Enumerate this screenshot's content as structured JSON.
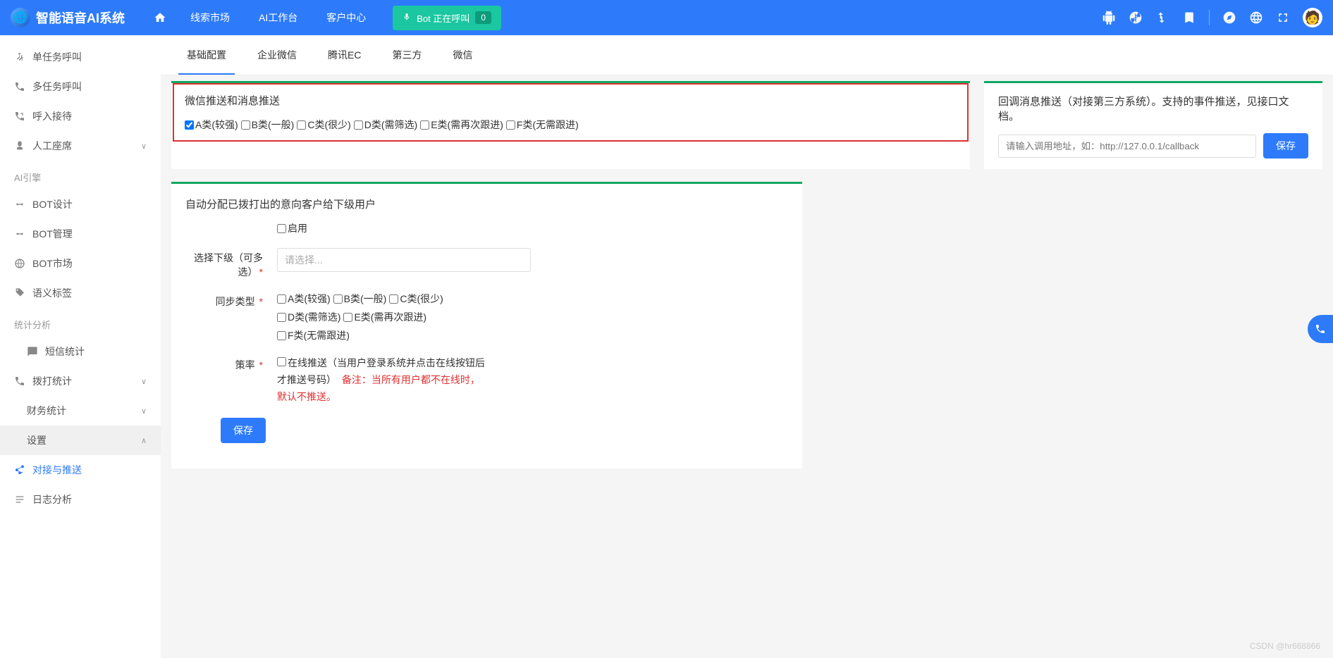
{
  "header": {
    "app_title": "智能语音AI系统",
    "nav": [
      "线索市场",
      "AI工作台",
      "客户中心"
    ],
    "bot_status_label": "Bot 正在呼叫",
    "bot_count": "0"
  },
  "sidebar": {
    "top_items": [
      {
        "icon": "call-split",
        "label": "单任务呼叫",
        "chev": false
      },
      {
        "icon": "phone",
        "label": "多任务呼叫",
        "chev": false
      },
      {
        "icon": "incoming",
        "label": "呼入接待",
        "chev": false
      },
      {
        "icon": "seat",
        "label": "人工座席",
        "chev": true
      }
    ],
    "group_ai": "AI引擎",
    "ai_items": [
      {
        "icon": "bot",
        "label": "BOT设计"
      },
      {
        "icon": "bot",
        "label": "BOT管理"
      },
      {
        "icon": "globe",
        "label": "BOT市场"
      },
      {
        "icon": "tag",
        "label": "语义标签"
      }
    ],
    "group_stat": "统计分析",
    "stat_items": [
      {
        "icon": "chat",
        "label": "短信统计",
        "chev": false
      },
      {
        "icon": "phone",
        "label": "拨打统计",
        "chev": true
      },
      {
        "icon": "",
        "label": "财务统计",
        "chev": true
      },
      {
        "icon": "",
        "label": "设置",
        "chev": true,
        "active_bg": true,
        "chev_up": true
      }
    ],
    "setting_sub": [
      {
        "icon": "share",
        "label": "对接与推送",
        "active": true
      },
      {
        "icon": "log",
        "label": "日志分析"
      }
    ]
  },
  "tabs": [
    "基础配置",
    "企业微信",
    "腾讯EC",
    "第三方",
    "微信"
  ],
  "active_tab": 0,
  "panel1": {
    "title": "微信推送和消息推送",
    "checks": [
      {
        "label": "A类(较强)",
        "checked": true
      },
      {
        "label": "B类(一般)",
        "checked": false
      },
      {
        "label": "C类(很少)",
        "checked": false
      },
      {
        "label": "D类(需筛选)",
        "checked": false
      },
      {
        "label": "E类(需再次跟进)",
        "checked": false
      },
      {
        "label": "F类(无需跟进)",
        "checked": false
      }
    ]
  },
  "panel_callback": {
    "title": "回调消息推送（对接第三方系统）。支持的事件推送，见接口文档。",
    "placeholder": "请输入调用地址，如：http://127.0.0.1/callback",
    "save_btn": "保存"
  },
  "panel2": {
    "title": "自动分配已拨打出的意向客户给下级用户",
    "enable_label": "启用",
    "enable_checked": false,
    "row_select": {
      "label": "选择下级（可多选）",
      "placeholder": "请选择..."
    },
    "row_type": {
      "label": "同步类型",
      "checks_rows": [
        [
          {
            "label": "A类(较强)"
          },
          {
            "label": "B类(一般)"
          },
          {
            "label": "C类(很少)"
          }
        ],
        [
          {
            "label": "D类(需筛选)"
          },
          {
            "label": "E类(需再次跟进)"
          }
        ],
        [
          {
            "label": "F类(无需跟进)"
          }
        ]
      ]
    },
    "row_strategy": {
      "label": "策率",
      "text_black": "在线推送（当用户登录系统并点击在线按钮后才推送号码）",
      "text_red": "备注：当所有用户都不在线时，默认不推送。"
    },
    "save_btn": "保存"
  },
  "watermark": "CSDN @hr668866"
}
